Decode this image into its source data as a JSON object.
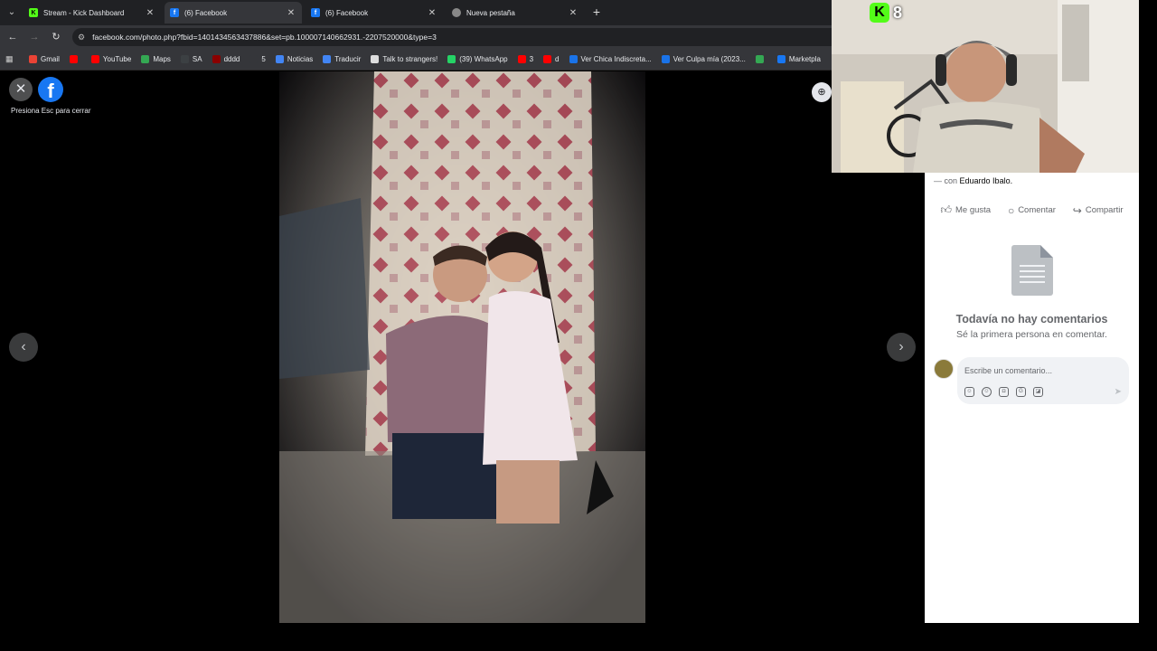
{
  "browser": {
    "tabs": [
      {
        "label": "Stream - Kick Dashboard",
        "icon": "kick-icon",
        "active": false
      },
      {
        "label": "(6) Facebook",
        "icon": "facebook-icon",
        "active": true
      },
      {
        "label": "(6) Facebook",
        "icon": "facebook-icon",
        "active": false
      },
      {
        "label": "Nueva pestaña",
        "icon": "chrome-icon",
        "active": false
      }
    ],
    "url": "facebook.com/photo.php?fbid=1401434563437886&set=pb.100007140662931.-2207520000&type=3",
    "bookmarks": [
      {
        "label": "Gmail",
        "color": "#ea4335"
      },
      {
        "label": "",
        "color": "#ff0000"
      },
      {
        "label": "YouTube",
        "color": "#ff0000"
      },
      {
        "label": "Maps",
        "color": "#34a853"
      },
      {
        "label": "SA",
        "color": "#3c4043"
      },
      {
        "label": "dddd",
        "color": "#8b0000"
      },
      {
        "label": "5",
        "color": "#35363a"
      },
      {
        "label": "Noticias",
        "color": "#4285f4"
      },
      {
        "label": "Traducir",
        "color": "#4285f4"
      },
      {
        "label": "Talk to strangers!",
        "color": "#dddddd"
      },
      {
        "label": "(39) WhatsApp",
        "color": "#25d366"
      },
      {
        "label": "3",
        "color": "#ff0000"
      },
      {
        "label": "d",
        "color": "#ff0000"
      },
      {
        "label": "Ver Chica Indiscreta...",
        "color": "#1a73e8"
      },
      {
        "label": "Ver Culpa mía (2023...",
        "color": "#1a73e8"
      },
      {
        "label": "",
        "color": "#34a853"
      },
      {
        "label": "Marketpla",
        "color": "#1877f2"
      }
    ]
  },
  "viewer": {
    "esc_hint": "Presiona Esc para cerrar",
    "close_symbol": "✕",
    "prev_symbol": "‹",
    "next_symbol": "›",
    "zoom_symbol": "⊕"
  },
  "overlay": {
    "kick_letter": "K",
    "viewer_count": "8"
  },
  "panel": {
    "with_prefix": "— con",
    "with_name": "Eduardo Ibalo.",
    "actions": {
      "like": "Me gusta",
      "comment": "Comentar",
      "share": "Compartir"
    },
    "empty_title": "Todavía no hay comentarios",
    "empty_subtitle": "Sé la primera persona en comentar.",
    "comment_placeholder": "Escribe un comentario..."
  },
  "colors": {
    "facebook_blue": "#1877f2",
    "kick_green": "#53fc18",
    "chrome_dark": "#202124"
  }
}
